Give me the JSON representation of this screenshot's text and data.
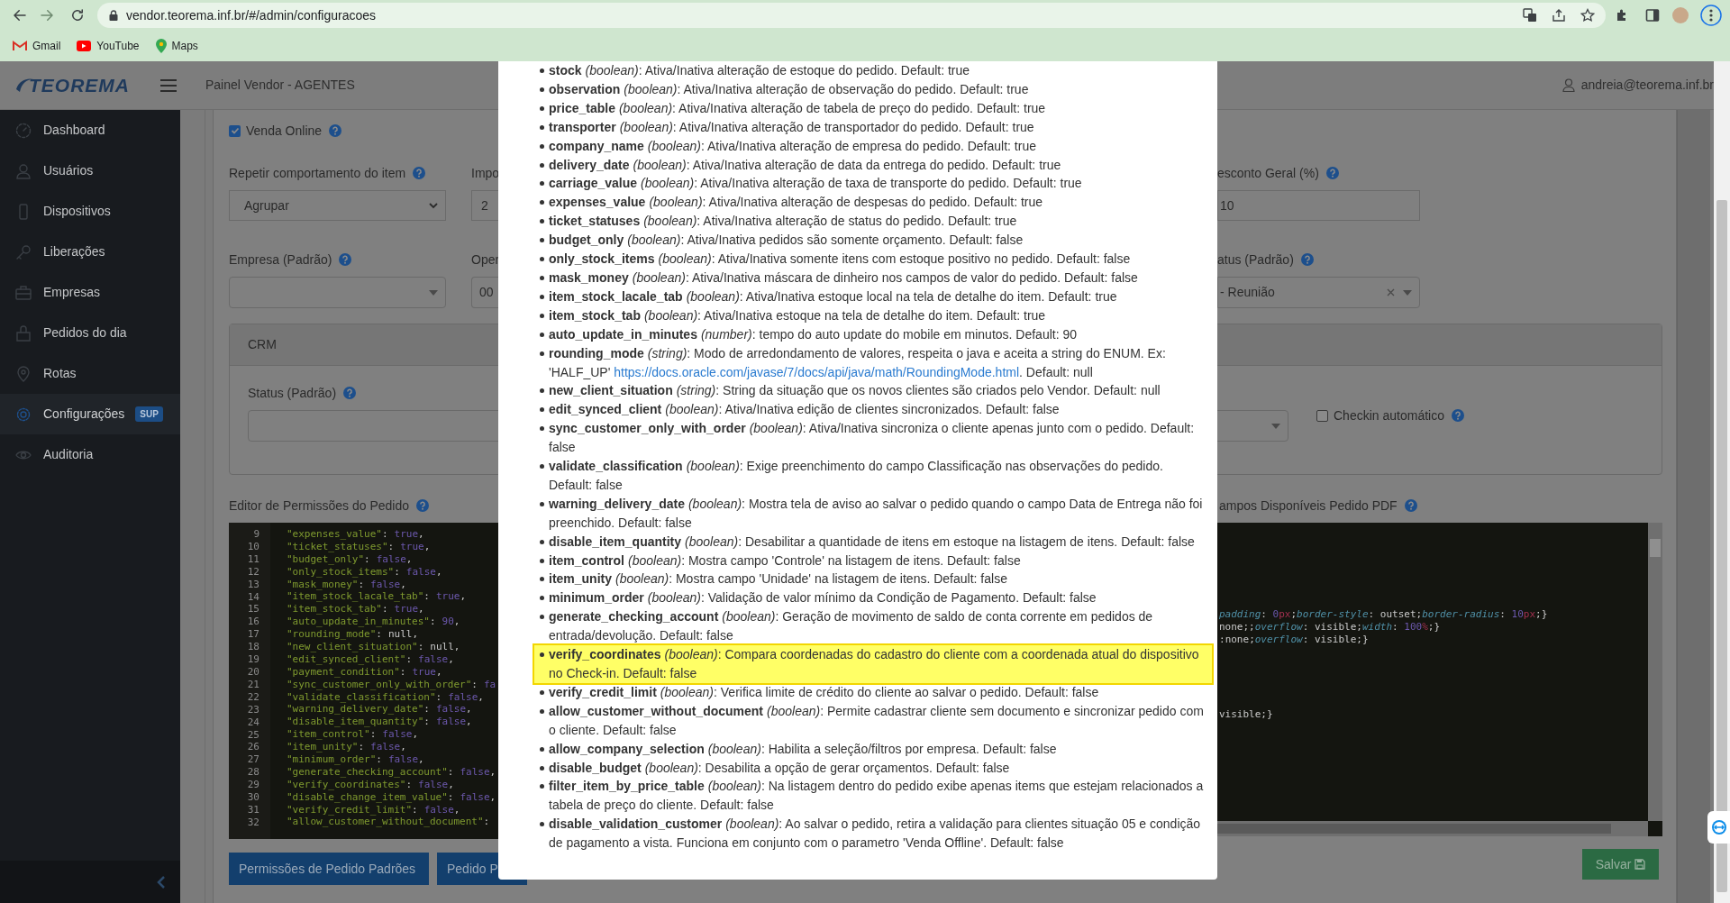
{
  "browser": {
    "url": "vendor.teorema.inf.br/#/admin/configuracoes",
    "bookmarks": [
      "Gmail",
      "YouTube",
      "Maps"
    ]
  },
  "header": {
    "logo": "TEOREMA",
    "title": "Painel Vendor - AGENTES",
    "user": "andreia@teorema.inf.br"
  },
  "sidebar": {
    "items": [
      {
        "label": "Dashboard",
        "selected": false
      },
      {
        "label": "Usuários",
        "selected": false
      },
      {
        "label": "Dispositivos",
        "selected": false
      },
      {
        "label": "Liberações",
        "selected": false
      },
      {
        "label": "Empresas",
        "selected": false
      },
      {
        "label": "Pedidos do dia",
        "selected": false
      },
      {
        "label": "Rotas",
        "selected": false
      },
      {
        "label": "Configurações",
        "selected": true,
        "badge": "SUP"
      },
      {
        "label": "Auditoria",
        "selected": false
      }
    ]
  },
  "form": {
    "venda_online": {
      "label": "Venda Online",
      "checked": true
    },
    "repetir": {
      "label": "Repetir comportamento do item",
      "value": "Agrupar"
    },
    "column_2_top": {
      "label": "Impo",
      "value": "2"
    },
    "empresa": {
      "label": "Empresa (Padrão)"
    },
    "column_2_middle": {
      "label": "Oper",
      "value": "00"
    },
    "desconto": {
      "label": "esconto Geral (%)",
      "value": "10"
    },
    "status": {
      "label": "atus (Padrão)",
      "value": "- Reunião"
    },
    "crm": {
      "title": "CRM",
      "status_label": "Status (Padrão)",
      "checkin": {
        "label": "Checkin automático",
        "checked": false
      }
    },
    "editor_label": "Editor de Permissões do Pedido",
    "pdf_label": "ampos Disponíveis Pedido PDF",
    "editor_lines": [
      {
        "number": "9",
        "key": "\"expenses_value\"",
        "colon": ":",
        "value": "true",
        "comma": ",",
        "kind": "bool"
      },
      {
        "number": "10",
        "key": "\"ticket_statuses\"",
        "colon": ":",
        "value": "true",
        "comma": ",",
        "kind": "bool"
      },
      {
        "number": "11",
        "key": "\"budget_only\"",
        "colon": ":",
        "value": "false",
        "comma": ",",
        "kind": "bool"
      },
      {
        "number": "12",
        "key": "\"only_stock_items\"",
        "colon": ":",
        "value": "false",
        "comma": ",",
        "kind": "bool"
      },
      {
        "number": "13",
        "key": "\"mask_money\"",
        "colon": ":",
        "value": "false",
        "comma": ",",
        "kind": "bool"
      },
      {
        "number": "14",
        "key": "\"item_stock_lacale_tab\"",
        "colon": ":",
        "value": "true",
        "comma": ",",
        "kind": "bool"
      },
      {
        "number": "15",
        "key": "\"item_stock_tab\"",
        "colon": ":",
        "value": "true",
        "comma": ",",
        "kind": "bool"
      },
      {
        "number": "16",
        "key": "\"auto_update_in_minutes\"",
        "colon": ":",
        "value": "90",
        "comma": ",",
        "kind": "number"
      },
      {
        "number": "17",
        "key": "\"rounding_mode\"",
        "colon": ":",
        "value": "null",
        "comma": ",",
        "kind": "null"
      },
      {
        "number": "18",
        "key": "\"new_client_situation\"",
        "colon": ":",
        "value": "null",
        "comma": ",",
        "kind": "null"
      },
      {
        "number": "19",
        "key": "\"edit_synced_client\"",
        "colon": ":",
        "value": "false",
        "comma": ",",
        "kind": "bool"
      },
      {
        "number": "20",
        "key": "\"payment_condition\"",
        "colon": ":",
        "value": "true",
        "comma": ",",
        "kind": "bool"
      },
      {
        "number": "21",
        "key": "\"sync_customer_only_with_order\"",
        "colon": ":",
        "value": "fa",
        "kind": "bool"
      },
      {
        "number": "22",
        "key": "\"validate_classification\"",
        "colon": ":",
        "value": "false",
        "comma": ",",
        "kind": "bool"
      },
      {
        "number": "23",
        "key": "\"warning_delivery_date\"",
        "colon": ":",
        "value": "false",
        "comma": ",",
        "kind": "bool"
      },
      {
        "number": "24",
        "key": "\"disable_item_quantity\"",
        "colon": ":",
        "value": "false",
        "comma": ",",
        "kind": "bool"
      },
      {
        "number": "25",
        "key": "\"item_control\"",
        "colon": ":",
        "value": "false",
        "comma": ",",
        "kind": "bool"
      },
      {
        "number": "26",
        "key": "\"item_unity\"",
        "colon": ":",
        "value": "false",
        "comma": ",",
        "kind": "bool"
      },
      {
        "number": "27",
        "key": "\"minimum_order\"",
        "colon": ":",
        "value": "false",
        "comma": ",",
        "kind": "bool"
      },
      {
        "number": "28",
        "key": "\"generate_checking_account\"",
        "colon": ":",
        "value": "false",
        "comma": ",",
        "kind": "bool"
      },
      {
        "number": "29",
        "key": "\"verify_coordinates\"",
        "colon": ":",
        "value": "false",
        "comma": ",",
        "kind": "bool"
      },
      {
        "number": "30",
        "key": "\"disable_change_item_value\"",
        "colon": ":",
        "value": "false",
        "comma": ",",
        "kind": "bool"
      },
      {
        "number": "31",
        "key": "\"verify_credit_limit\"",
        "colon": ":",
        "value": "false",
        "comma": ",",
        "kind": "bool"
      },
      {
        "number": "32",
        "key": "\"allow_customer_without_document\"",
        "colon": ":"
      }
    ],
    "pdf_lines": [
      [
        {
          "t": "padding",
          "kind": "prop"
        },
        {
          "t": ": ",
          "kind": "punct"
        },
        {
          "t": "0",
          "kind": "number"
        },
        {
          "t": "px",
          "kind": "unit"
        },
        {
          "t": ";",
          "kind": "punct"
        },
        {
          "t": "border-style",
          "kind": "prop"
        },
        {
          "t": ": ",
          "kind": "punct"
        },
        {
          "t": "outset",
          "kind": "value"
        },
        {
          "t": ";",
          "kind": "punct"
        },
        {
          "t": "border-radius",
          "kind": "prop"
        },
        {
          "t": ": ",
          "kind": "punct"
        },
        {
          "t": "10",
          "kind": "number"
        },
        {
          "t": "px",
          "kind": "unit"
        },
        {
          "t": ";}",
          "kind": "punct"
        }
      ],
      [
        {
          "t": "none",
          "kind": "value"
        },
        {
          "t": ";;",
          "kind": "punct"
        },
        {
          "t": "overflow",
          "kind": "prop"
        },
        {
          "t": ": ",
          "kind": "punct"
        },
        {
          "t": "visible",
          "kind": "value"
        },
        {
          "t": ";",
          "kind": "punct"
        },
        {
          "t": "width",
          "kind": "prop"
        },
        {
          "t": ": ",
          "kind": "punct"
        },
        {
          "t": "100",
          "kind": "number"
        },
        {
          "t": "%",
          "kind": "unit"
        },
        {
          "t": ";}",
          "kind": "punct"
        }
      ],
      [
        {
          "t": ":",
          "kind": "punct"
        },
        {
          "t": "none",
          "kind": "value"
        },
        {
          "t": ";",
          "kind": "punct"
        },
        {
          "t": "overflow",
          "kind": "prop"
        },
        {
          "t": ": ",
          "kind": "punct"
        },
        {
          "t": "visible",
          "kind": "value"
        },
        {
          "t": ";}",
          "kind": "punct"
        }
      ],
      [
        {
          "t": "visible",
          "kind": "value"
        },
        {
          "t": ";}",
          "kind": "punct"
        }
      ]
    ],
    "buttons": [
      "Permissões de Pedido Padrões",
      "Pedido P"
    ],
    "save_button": "Salvar"
  },
  "modal": {
    "items": [
      {
        "key": "stock",
        "type": "(boolean)",
        "text": ": Ativa/Inativa alteração de estoque do pedido. Default: true",
        "highlighted": false
      },
      {
        "key": "observation",
        "type": "(boolean)",
        "text": ": Ativa/Inativa alteração de observação do pedido. Default: true",
        "highlighted": false
      },
      {
        "key": "price_table",
        "type": "(boolean)",
        "text": ": Ativa/Inativa alteração de tabela de preço do pedido. Default: true",
        "highlighted": false
      },
      {
        "key": "transporter",
        "type": "(boolean)",
        "text": ": Ativa/Inativa alteração de transportador do pedido. Default: true",
        "highlighted": false
      },
      {
        "key": "company_name",
        "type": "(boolean)",
        "text": ": Ativa/Inativa alteração de empresa do pedido. Default: true",
        "highlighted": false
      },
      {
        "key": "delivery_date",
        "type": "(boolean)",
        "text": ": Ativa/Inativa alteração de data da entrega do pedido. Default: true",
        "highlighted": false
      },
      {
        "key": "carriage_value",
        "type": "(boolean)",
        "text": ": Ativa/Inativa alteração de taxa de transporte do pedido. Default: true",
        "highlighted": false
      },
      {
        "key": "expenses_value",
        "type": "(boolean)",
        "text": ": Ativa/Inativa alteração de despesas do pedido. Default: true",
        "highlighted": false
      },
      {
        "key": "ticket_statuses",
        "type": "(boolean)",
        "text": ": Ativa/Inativa alteração de status do pedido. Default: true",
        "highlighted": false
      },
      {
        "key": "budget_only",
        "type": "(boolean)",
        "text": ": Ativa/Inativa pedidos são somente orçamento. Default: false",
        "highlighted": false
      },
      {
        "key": "only_stock_items",
        "type": "(boolean)",
        "text": ": Ativa/Inativa somente itens com estoque positivo no pedido. Default: false",
        "highlighted": false
      },
      {
        "key": "mask_money",
        "type": "(boolean)",
        "text": ": Ativa/Inativa máscara de dinheiro nos campos de valor do pedido. Default: false",
        "highlighted": false
      },
      {
        "key": "item_stock_lacale_tab",
        "type": "(boolean)",
        "text": ": Ativa/Inativa estoque local na tela de detalhe do item. Default: true",
        "highlighted": false
      },
      {
        "key": "item_stock_tab",
        "type": "(boolean)",
        "text": ": Ativa/Inativa estoque na tela de detalhe do item. Default: true",
        "highlighted": false
      },
      {
        "key": "auto_update_in_minutes",
        "type": "(number)",
        "text": ": tempo do auto update do mobile em minutos. Default: 90",
        "highlighted": false
      },
      {
        "key": "rounding_mode",
        "type": "(string)",
        "text": ": Modo de arredondamento de valores, respeita o java e aceita a string do ENUM. Ex: 'HALF_UP'",
        "link": "https://docs.oracle.com/javase/7/docs/api/java/math/RoundingMode.html",
        "text_after": ". Default: null",
        "highlighted": false
      },
      {
        "key": "new_client_situation",
        "type": "(string)",
        "text": ": String da situação que os novos clientes são criados pelo Vendor. Default: null",
        "highlighted": false
      },
      {
        "key": "edit_synced_client",
        "type": "(boolean)",
        "text": ": Ativa/Inativa edição de clientes sincronizados. Default: false",
        "highlighted": false
      },
      {
        "key": "sync_customer_only_with_order",
        "type": "(boolean)",
        "text": ": Ativa/Inativa sincroniza o cliente apenas junto com o pedido. Default: false",
        "highlighted": false
      },
      {
        "key": "validate_classification",
        "type": "(boolean)",
        "text": ": Exige preenchimento do campo Classificação nas observações do pedido. Default: false",
        "highlighted": false
      },
      {
        "key": "warning_delivery_date",
        "type": "(boolean)",
        "text": ": Mostra tela de aviso ao salvar o pedido quando o campo Data de Entrega não foi preenchido. Default: false",
        "highlighted": false
      },
      {
        "key": "disable_item_quantity",
        "type": "(boolean)",
        "text": ": Desabilitar a quantidade de itens em estoque na listagem de itens. Default: false",
        "highlighted": false
      },
      {
        "key": "item_control",
        "type": "(boolean)",
        "text": ": Mostra campo 'Controle' na listagem de itens. Default: false",
        "highlighted": false
      },
      {
        "key": "item_unity",
        "type": "(boolean)",
        "text": ": Mostra campo 'Unidade' na listagem de itens. Default: false",
        "highlighted": false
      },
      {
        "key": "minimum_order",
        "type": "(boolean)",
        "text": ": Validação de valor mínimo da Condição de Pagamento. Default: false",
        "highlighted": false
      },
      {
        "key": "generate_checking_account",
        "type": "(boolean)",
        "text": ": Geração de movimento de saldo de conta corrente em pedidos de entrada/devolução. Default: false",
        "highlighted": false
      },
      {
        "key": "verify_coordinates",
        "type": "(boolean)",
        "text": ": Compara coordenadas do cadastro do cliente com a coordenada atual do dispositivo no Check-in. Default: false",
        "highlighted": true
      },
      {
        "key": "verify_credit_limit",
        "type": "(boolean)",
        "text": ": Verifica limite de crédito do cliente ao salvar o pedido. Default: false",
        "highlighted": false
      },
      {
        "key": "allow_customer_without_document",
        "type": "(boolean)",
        "text": ": Permite cadastrar cliente sem documento e sincronizar pedido com o cliente. Default: false",
        "highlighted": false
      },
      {
        "key": "allow_company_selection",
        "type": "(boolean)",
        "text": ": Habilita a seleção/filtros por empresa. Default: false",
        "highlighted": false
      },
      {
        "key": "disable_budget",
        "type": "(boolean)",
        "text": ": Desabilita a opção de gerar orçamentos. Default: false",
        "highlighted": false
      },
      {
        "key": "filter_item_by_price_table",
        "type": "(boolean)",
        "text": ": Na listagem dentro do pedido exibe apenas items que estejam relacionados a tabela de preço do cliente. Default: false",
        "highlighted": false
      },
      {
        "key": "disable_validation_customer",
        "type": "(boolean)",
        "text": ": Ao salvar o pedido, retira a validação para clientes situação 05 e condição de pagamento a vista. Funciona em conjunto com o parametro 'Venda Offline'. Default: false",
        "highlighted": false
      }
    ]
  }
}
